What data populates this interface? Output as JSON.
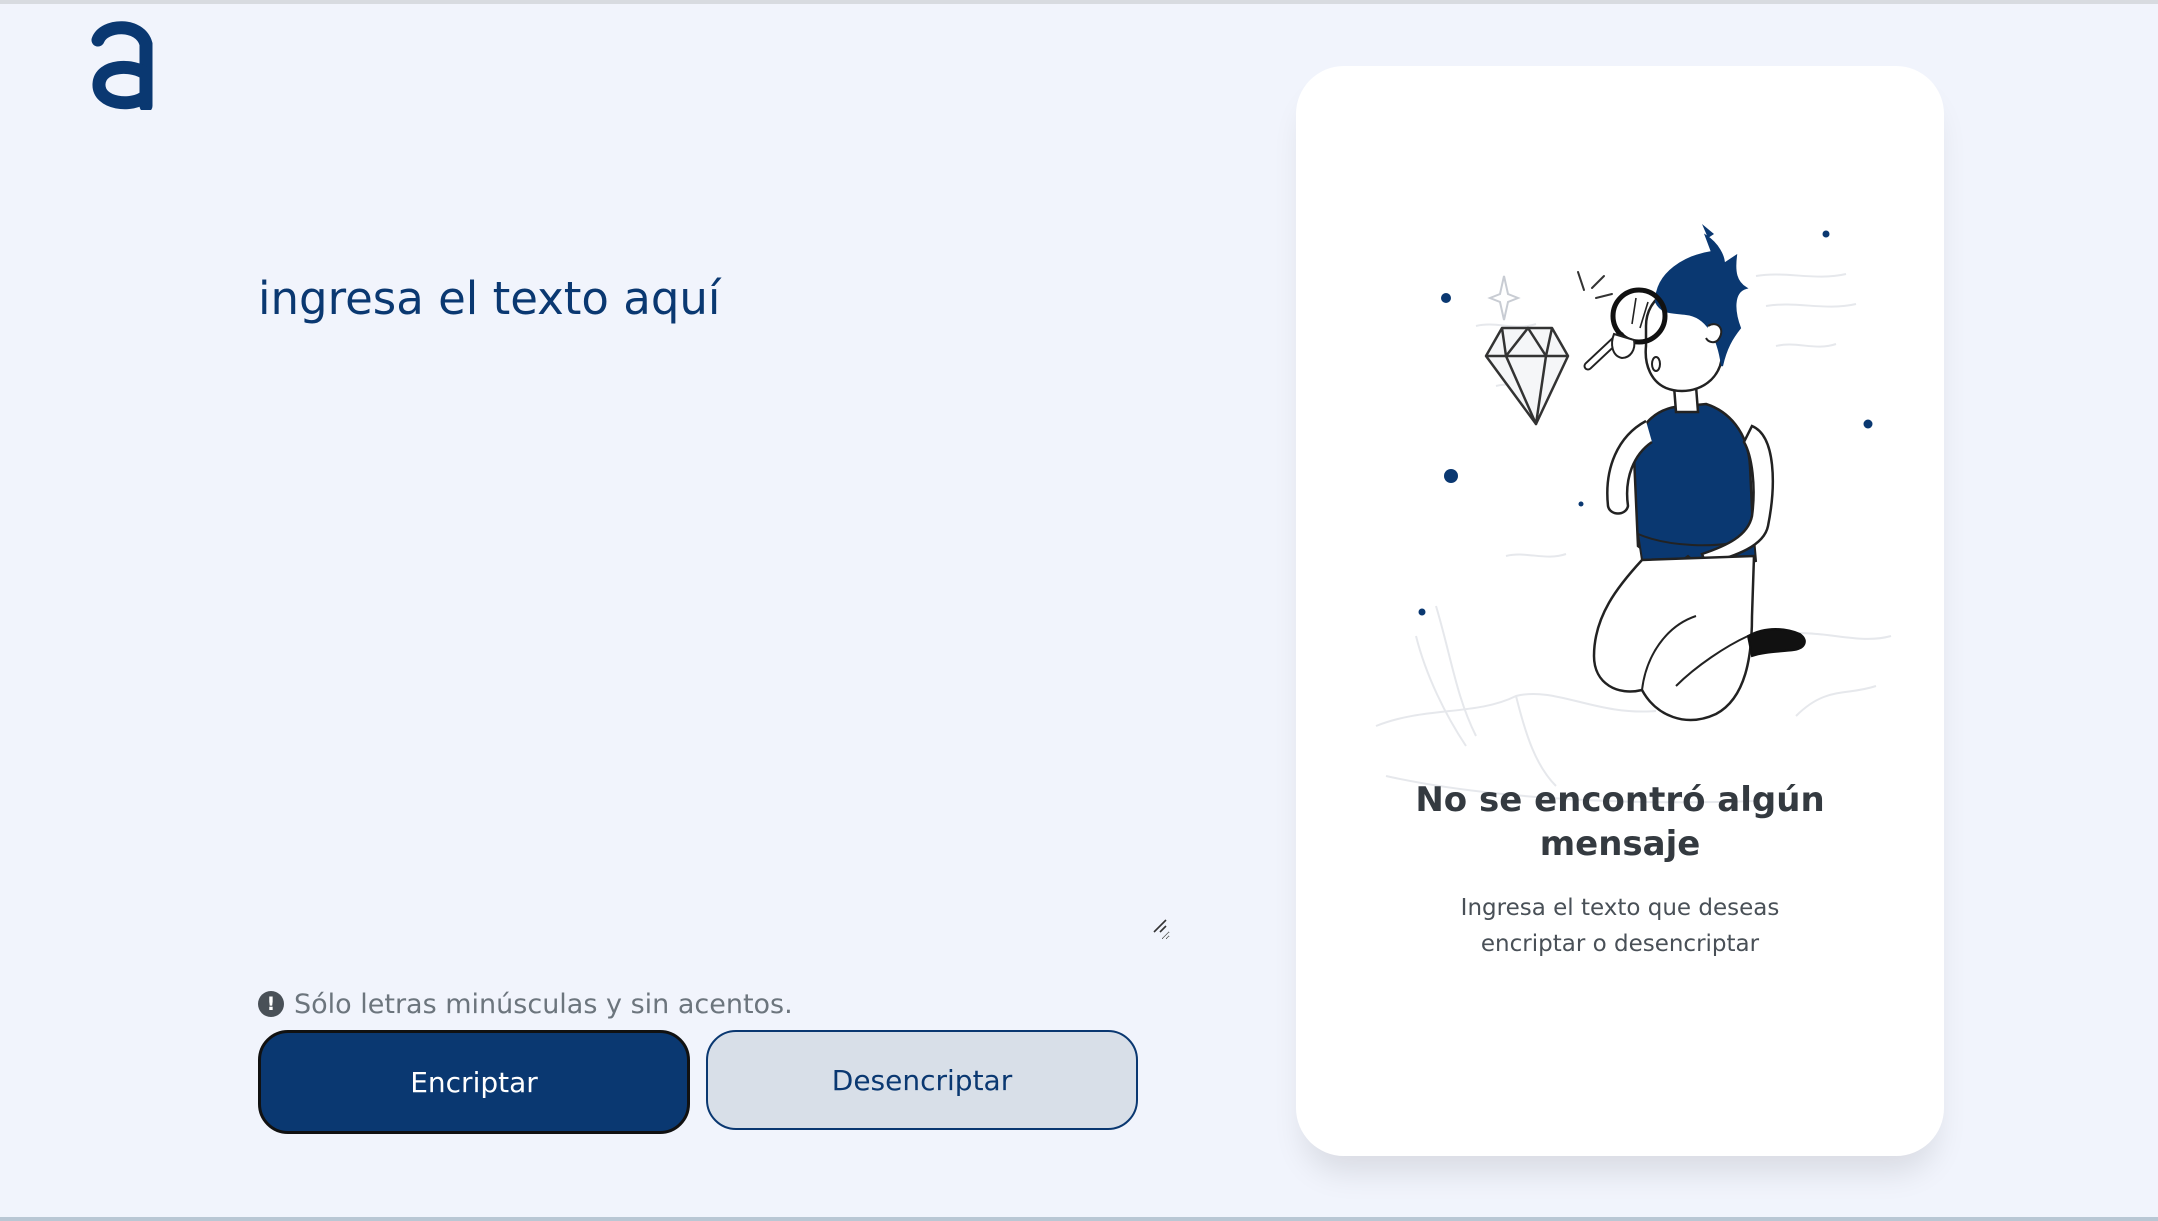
{
  "header": {
    "logo_icon": "alura-a-logo-icon"
  },
  "input": {
    "placeholder": "ingresa el texto aquí",
    "value": ""
  },
  "hint": {
    "icon": "exclamation-circle-icon",
    "text": "Sólo letras minúsculas y sin acentos."
  },
  "buttons": {
    "encrypt_label": "Encriptar",
    "decrypt_label": "Desencriptar"
  },
  "output_card": {
    "illustration": "person-with-magnifying-glass-looking-at-diamond",
    "title_line1": "No se encontró algún",
    "title_line2": "mensaje",
    "subtitle_line1": "Ingresa el texto que deseas",
    "subtitle_line2": "encriptar o desencriptar"
  },
  "colors": {
    "background": "#f1f4fc",
    "primary": "#0a3871",
    "secondary_button": "#d8dfe8",
    "card": "#ffffff",
    "hint_text": "#6c757d"
  }
}
